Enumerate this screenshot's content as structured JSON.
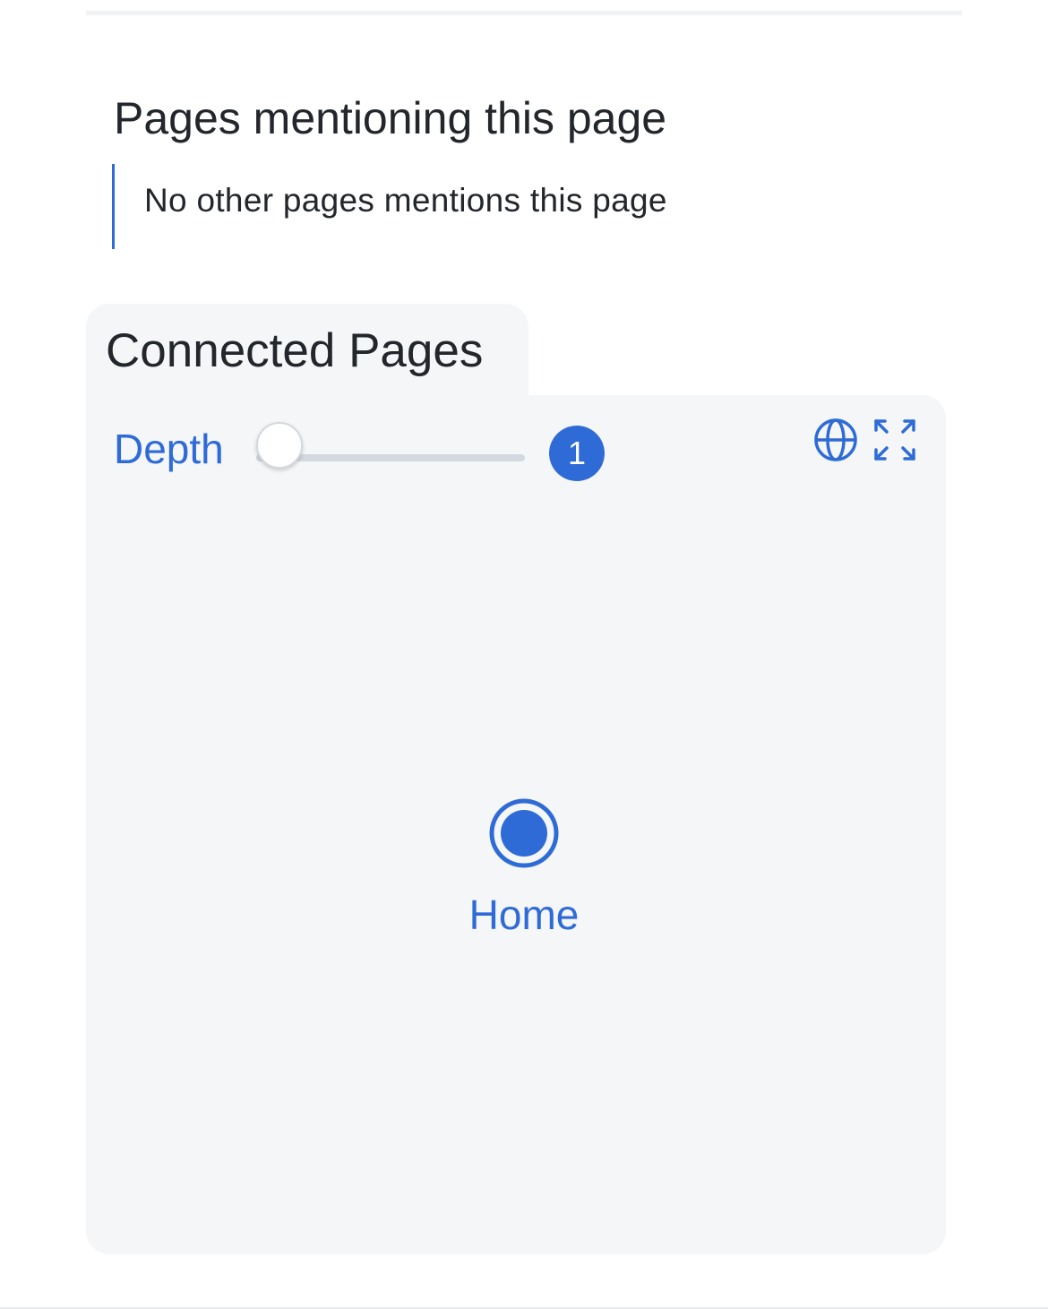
{
  "mentions": {
    "title": "Pages mentioning this page",
    "empty_text": "No other pages mentions this page"
  },
  "connected_pages": {
    "title": "Connected Pages",
    "depth_label": "Depth",
    "depth_value": "1",
    "depth_slider_fraction": 0,
    "nodes": [
      {
        "label": "Home"
      }
    ],
    "icons": {
      "global_graph": "globe-icon",
      "fullscreen": "expand-icon"
    }
  },
  "colors": {
    "accent": "#2f6bd6",
    "panel_bg": "#f4f6f8",
    "text": "#23262b"
  }
}
